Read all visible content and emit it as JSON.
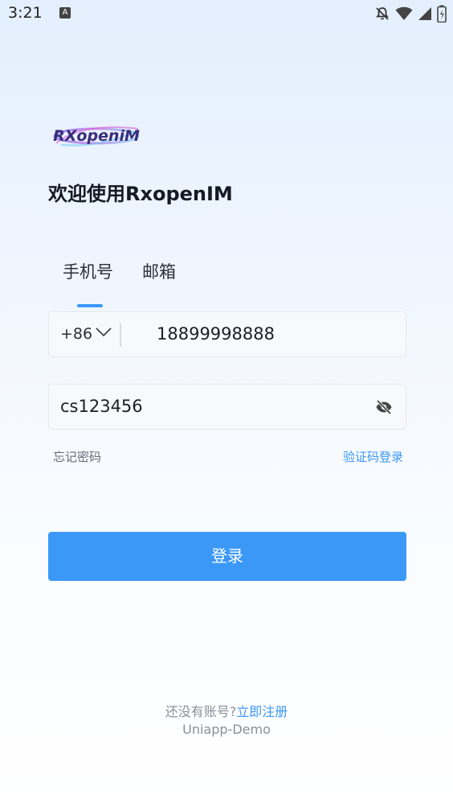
{
  "status_bar": {
    "time": "3:21",
    "notification_letter": "A",
    "icons": [
      "bell-off-icon",
      "wifi-icon",
      "signal-icon",
      "battery-icon"
    ]
  },
  "brand": {
    "logo_text": "RXopeniM"
  },
  "welcome": "欢迎使用RxopenIM",
  "tabs": [
    {
      "label": "手机号",
      "active": true
    },
    {
      "label": "邮箱",
      "active": false
    }
  ],
  "phone": {
    "country_code": "+86",
    "value": "18899998888"
  },
  "password": {
    "value": "cs123456"
  },
  "links": {
    "forgot": "忘记密码",
    "code_login": "验证码登录"
  },
  "login_button": "登录",
  "footer": {
    "question": "还没有账号?",
    "register": "立即注册",
    "demo": "Uniapp-Demo"
  },
  "colors": {
    "accent": "#3b98f7",
    "text": "#1b1f27",
    "muted": "#8a8f98"
  }
}
